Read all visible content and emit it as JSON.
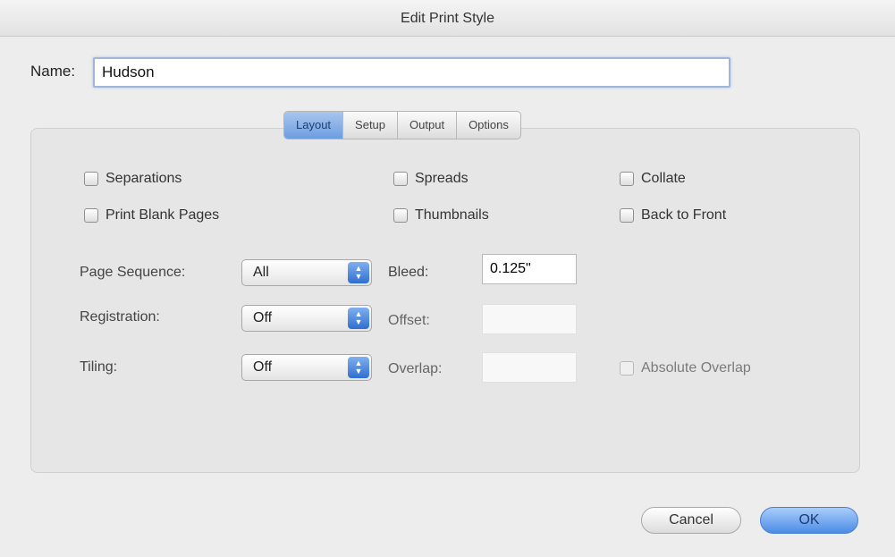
{
  "window": {
    "title": "Edit Print Style"
  },
  "name": {
    "label": "Name:",
    "value": "Hudson"
  },
  "tabs": [
    {
      "label": "Layout",
      "active": true
    },
    {
      "label": "Setup",
      "active": false
    },
    {
      "label": "Output",
      "active": false
    },
    {
      "label": "Options",
      "active": false
    }
  ],
  "layout": {
    "checkboxes": {
      "separations": {
        "label": "Separations",
        "checked": false
      },
      "spreads": {
        "label": "Spreads",
        "checked": false
      },
      "collate": {
        "label": "Collate",
        "checked": false
      },
      "print_blank_pages": {
        "label": "Print Blank Pages",
        "checked": false
      },
      "thumbnails": {
        "label": "Thumbnails",
        "checked": false
      },
      "back_to_front": {
        "label": "Back to Front",
        "checked": false
      },
      "absolute_overlap": {
        "label": "Absolute Overlap",
        "checked": false,
        "enabled": false
      }
    },
    "page_sequence": {
      "label": "Page Sequence:",
      "value": "All"
    },
    "registration": {
      "label": "Registration:",
      "value": "Off"
    },
    "tiling": {
      "label": "Tiling:",
      "value": "Off"
    },
    "bleed": {
      "label": "Bleed:",
      "value": "0.125\""
    },
    "offset": {
      "label": "Offset:",
      "value": ""
    },
    "overlap": {
      "label": "Overlap:",
      "value": ""
    }
  },
  "buttons": {
    "cancel": "Cancel",
    "ok": "OK"
  },
  "colors": {
    "accent": "#4c8ce6",
    "focus_ring": "#9fb6d8"
  }
}
